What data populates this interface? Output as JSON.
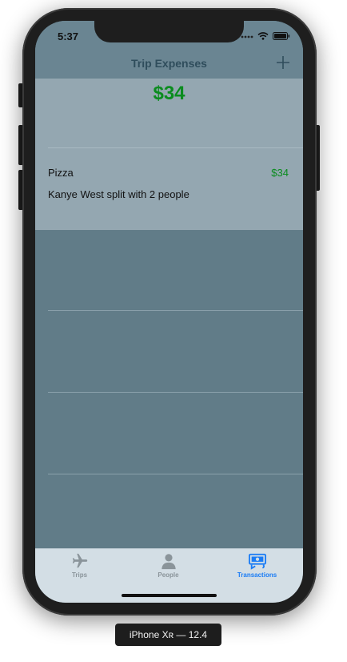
{
  "status_bar": {
    "time": "5:37"
  },
  "nav": {
    "title": "Trip Expenses",
    "add_icon": "plus-icon"
  },
  "summary": {
    "total": "$34"
  },
  "transactions": [
    {
      "name": "Pizza",
      "amount": "$34",
      "detail": "Kanye West split with 2 people"
    }
  ],
  "tabs": [
    {
      "label": "Trips",
      "icon": "airplane-icon",
      "active": false
    },
    {
      "label": "People",
      "icon": "person-icon",
      "active": false
    },
    {
      "label": "Transactions",
      "icon": "money-icon",
      "active": true
    }
  ],
  "device_label": "iPhone Xʀ — 12.4",
  "colors": {
    "screen_bg": "#617c88",
    "nav_bg": "#6a8592",
    "summary_bg": "#94a7b1",
    "amount_green": "#0a8c1e",
    "tab_active": "#1a7cf5",
    "tab_inactive": "#8a949a",
    "tab_bar_bg": "#d3dee5"
  }
}
